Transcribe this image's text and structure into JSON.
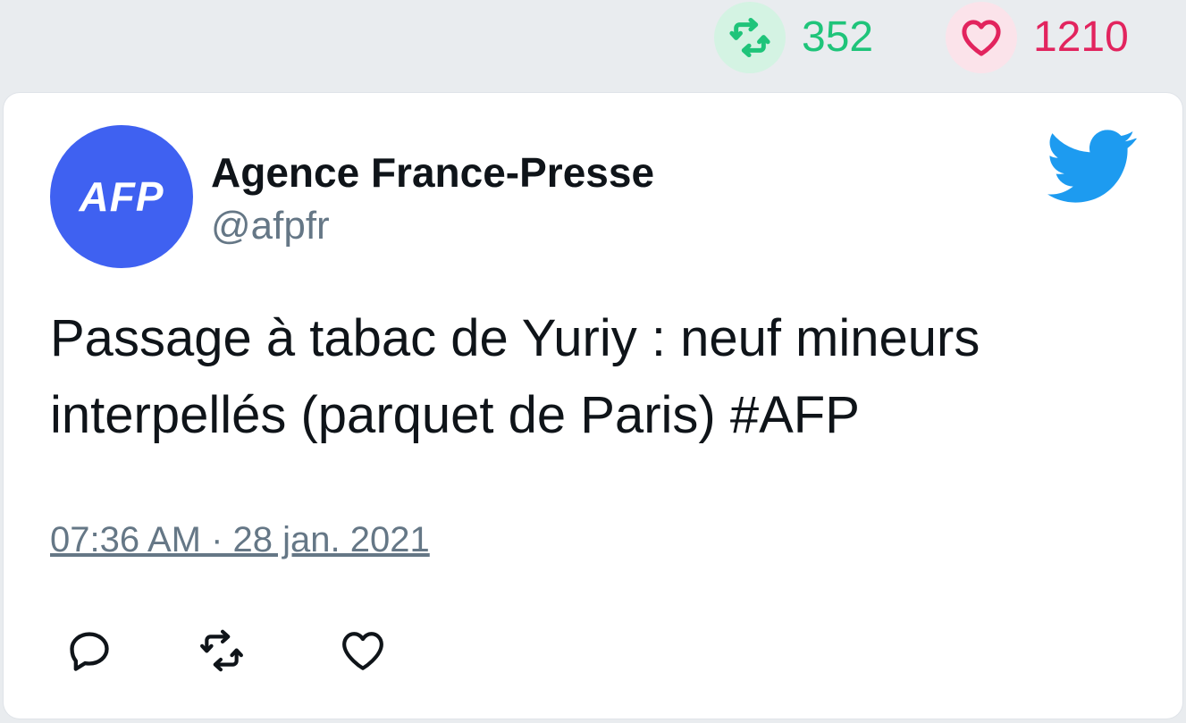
{
  "stats": {
    "retweet_count": "352",
    "like_count": "1210"
  },
  "tweet": {
    "avatar_text": "AFP",
    "display_name": "Agence France-Presse",
    "handle": "@afpfr",
    "text_line1": "Passage à tabac de Yuriy : neuf mineurs",
    "text_line2": "interpellés (parquet de Paris) #AFP",
    "timestamp": "07:36 AM · 28 jan. 2021"
  },
  "icons": {
    "retweet": "retweet-icon",
    "like": "heart-icon",
    "reply": "reply-icon",
    "brand": "twitter-bird-icon"
  },
  "colors": {
    "retweet_green": "#1fc47a",
    "like_red": "#e2245e",
    "twitter_blue": "#1d9bf0",
    "avatar_blue": "#3f61f1",
    "muted_gray": "#657786"
  }
}
